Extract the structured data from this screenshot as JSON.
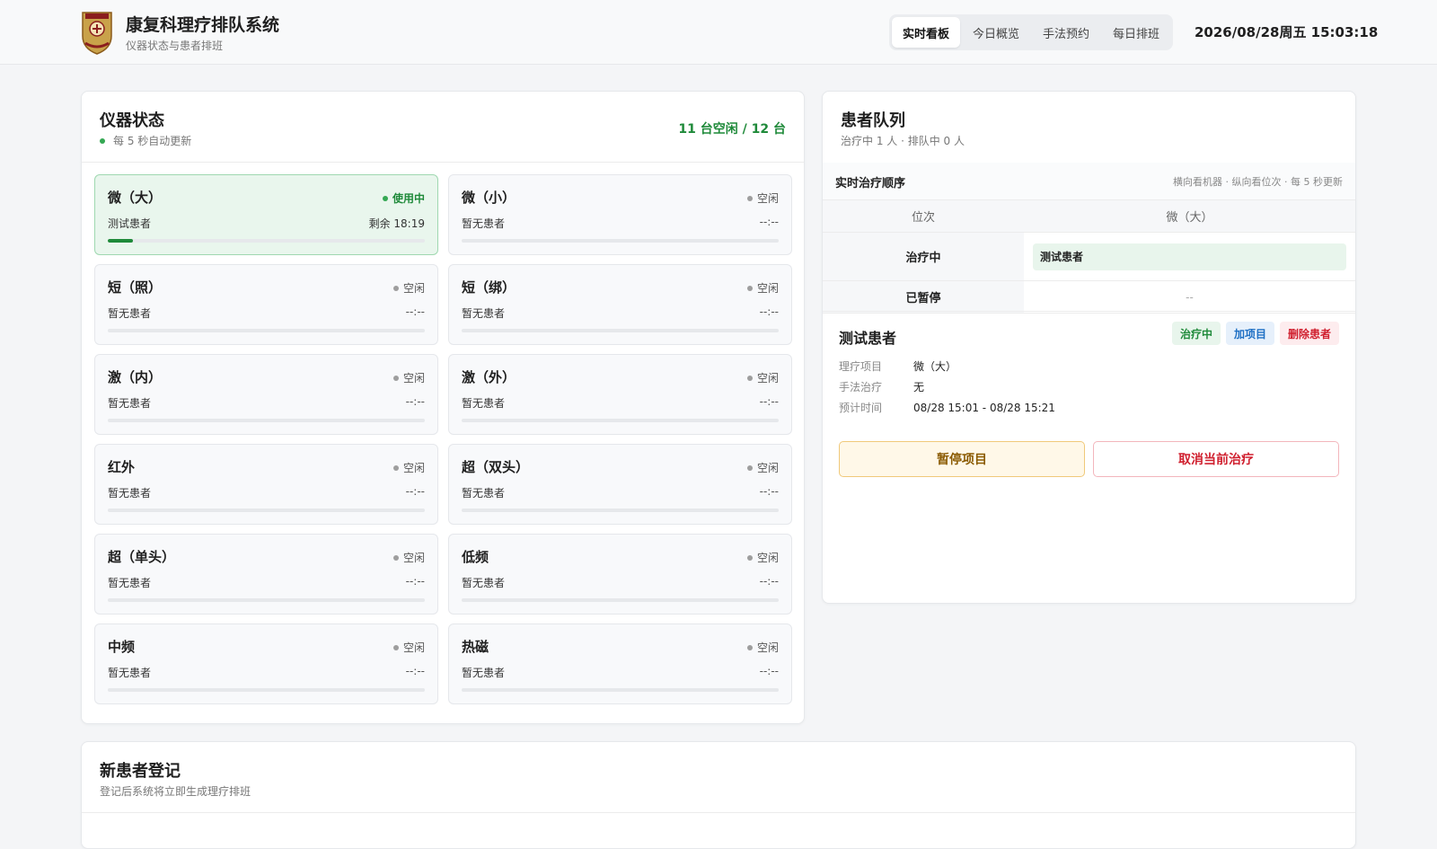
{
  "header": {
    "app_title": "康复科理疗排队系统",
    "app_subtitle": "仪器状态与患者排班",
    "tabs": [
      {
        "label": "实时看板",
        "active": true
      },
      {
        "label": "今日概览",
        "active": false
      },
      {
        "label": "手法预约",
        "active": false
      },
      {
        "label": "每日排班",
        "active": false
      }
    ],
    "clock": "2026/08/28周五 15:03:18"
  },
  "devices_panel": {
    "title": "仪器状态",
    "subtitle": "每 5 秒自动更新",
    "summary": "11 台空闲 / 12 台",
    "devices": [
      {
        "name": "微（大）",
        "status": "使用中",
        "patient": "测试患者",
        "time": "剩余 18:19",
        "active": true,
        "progress": 0.08
      },
      {
        "name": "微（小）",
        "status": "空闲",
        "patient": "暂无患者",
        "time": "--:--",
        "active": false,
        "progress": 0
      },
      {
        "name": "短（照）",
        "status": "空闲",
        "patient": "暂无患者",
        "time": "--:--",
        "active": false,
        "progress": 0
      },
      {
        "name": "短（绑）",
        "status": "空闲",
        "patient": "暂无患者",
        "time": "--:--",
        "active": false,
        "progress": 0
      },
      {
        "name": "激（内）",
        "status": "空闲",
        "patient": "暂无患者",
        "time": "--:--",
        "active": false,
        "progress": 0
      },
      {
        "name": "激（外）",
        "status": "空闲",
        "patient": "暂无患者",
        "time": "--:--",
        "active": false,
        "progress": 0
      },
      {
        "name": "红外",
        "status": "空闲",
        "patient": "暂无患者",
        "time": "--:--",
        "active": false,
        "progress": 0
      },
      {
        "name": "超（双头）",
        "status": "空闲",
        "patient": "暂无患者",
        "time": "--:--",
        "active": false,
        "progress": 0
      },
      {
        "name": "超（单头）",
        "status": "空闲",
        "patient": "暂无患者",
        "time": "--:--",
        "active": false,
        "progress": 0
      },
      {
        "name": "低频",
        "status": "空闲",
        "patient": "暂无患者",
        "time": "--:--",
        "active": false,
        "progress": 0
      },
      {
        "name": "中频",
        "status": "空闲",
        "patient": "暂无患者",
        "time": "--:--",
        "active": false,
        "progress": 0
      },
      {
        "name": "热磁",
        "status": "空闲",
        "patient": "暂无患者",
        "time": "--:--",
        "active": false,
        "progress": 0
      }
    ]
  },
  "queue_panel": {
    "title": "患者队列",
    "subtitle": "治疗中 1 人 · 排队中 0 人",
    "section_title": "实时治疗顺序",
    "section_note": "横向看机器 · 纵向看位次 · 每 5 秒更新",
    "table": {
      "col_position": "位次",
      "col_device": "微（大）",
      "row_treating_label": "治疗中",
      "row_treating_patient": "测试患者",
      "row_paused_label": "已暂停",
      "row_paused_value": "--"
    },
    "patient": {
      "name": "测试患者",
      "badge_status": "治疗中",
      "badge_add": "加项目",
      "badge_delete": "删除患者",
      "fields": [
        {
          "key": "理疗项目",
          "value": "微（大）"
        },
        {
          "key": "手法治疗",
          "value": "无"
        },
        {
          "key": "预计时间",
          "value": "08/28 15:01 - 08/28 15:21"
        }
      ],
      "pause_button": "暂停项目",
      "cancel_button": "取消当前治疗"
    }
  },
  "register_panel": {
    "title": "新患者登记",
    "subtitle": "登记后系统将立即生成理疗排班"
  },
  "colors": {
    "accent_green": "#1f8a3a",
    "danger_red": "#d0202f",
    "info_blue": "#1d6fc4",
    "warning_bg": "#fff8e8"
  }
}
